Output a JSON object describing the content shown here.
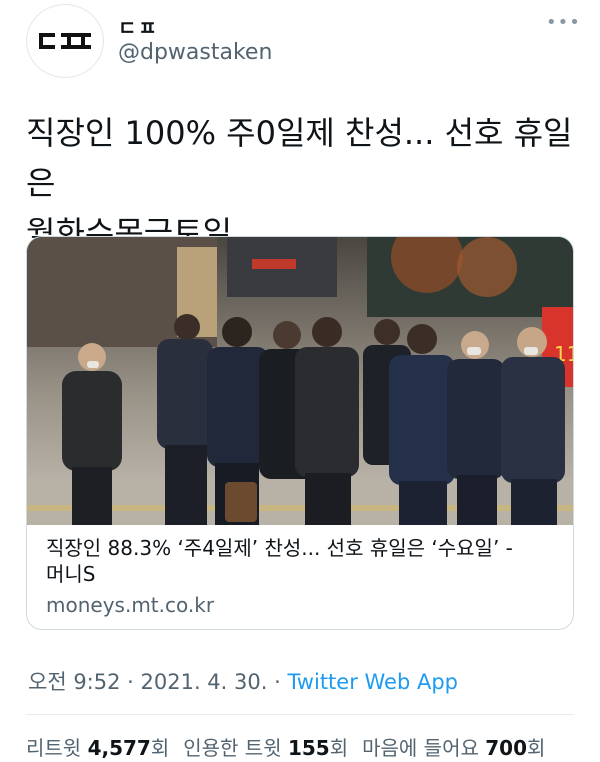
{
  "author": {
    "display_name": "ㄷㅍ",
    "handle": "@dpwastaken",
    "menu_icon": "more-icon"
  },
  "tweet": {
    "text_line1": "직장인 100% 주0일제 찬성... 선호 휴일은",
    "text_line2": "월화수목금토일"
  },
  "card": {
    "title_line1": "직장인 88.3% ‘주4일제’ 찬성... 선호 휴일은 ‘수요일’ -",
    "title_line2": "머니S",
    "domain": "moneys.mt.co.kr",
    "image_subject": "photo-people-walking-street",
    "sign_text": "11"
  },
  "meta": {
    "time": "오전 9:52",
    "sep1": " · ",
    "date": "2021. 4. 30.",
    "sep2": " · ",
    "app": "Twitter Web App"
  },
  "stats": {
    "retweets_label": "리트윗",
    "retweets_count": "4,577",
    "retweets_unit": "회",
    "quotes_label": "인용한 트윗",
    "quotes_count": "155",
    "quotes_unit": "회",
    "likes_label": "마음에 들어요",
    "likes_count": "700",
    "likes_unit": "회"
  }
}
